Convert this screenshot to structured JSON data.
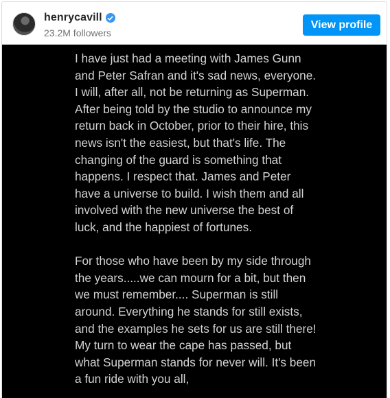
{
  "profile": {
    "username": "henrycavill",
    "followers": "23.2M followers",
    "view_profile_label": "View profile"
  },
  "post": {
    "paragraphs": [
      "I have just had a meeting with James Gunn and Peter Safran and it's sad news, everyone. I will, after all, not be returning as Superman. After being told by the studio to announce my return back in October, prior to their hire, this news isn't the easiest, but that's life. The changing of the guard is something that happens. I respect that. James and Peter have a universe to build. I wish them and all involved with the new universe the best of luck, and the happiest of fortunes.",
      "For those who have been by my side through the years.....we can mourn for a bit, but then we must remember.... Superman is still around. Everything he stands for still exists, and the examples he sets for us are still there! My turn to wear the cape has passed, but what Superman stands for never will. It's been a fun ride with you all,"
    ]
  },
  "colors": {
    "button": "#0095f6",
    "verified_badge": "#3897f0",
    "post_background": "#000000"
  },
  "icons": {
    "verified": "verified-badge-icon"
  }
}
